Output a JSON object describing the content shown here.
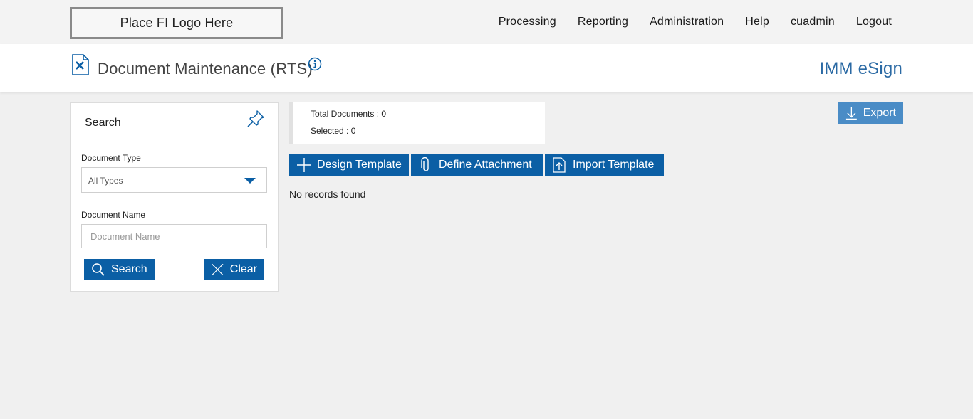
{
  "header": {
    "logo_text": "Place FI Logo Here",
    "nav": [
      "Processing",
      "Reporting",
      "Administration",
      "Help",
      "cuadmin",
      "Logout"
    ]
  },
  "titlebar": {
    "title": "Document Maintenance (RTS)",
    "brand": "IMM eSign",
    "icons": [
      "document-icon",
      "info-icon"
    ]
  },
  "search": {
    "title": "Search",
    "document_type_label": "Document Type",
    "document_type_value": "All Types",
    "document_name_label": "Document Name",
    "document_name_placeholder": "Document Name",
    "document_name_value": "",
    "search_label": "Search",
    "clear_label": "Clear"
  },
  "main": {
    "total_documents": "Total Documents : 0",
    "selected": "Selected : 0",
    "export_label": "Export",
    "design_template_label": "Design Template",
    "define_attachment_label": "Define Attachment",
    "import_template_label": "Import Template",
    "no_records": "No records found"
  },
  "colors": {
    "primary": "#0b5fa5",
    "export": "#4a8cc6",
    "brand_text": "#2b6aa4",
    "background": "#f0f0f0"
  }
}
